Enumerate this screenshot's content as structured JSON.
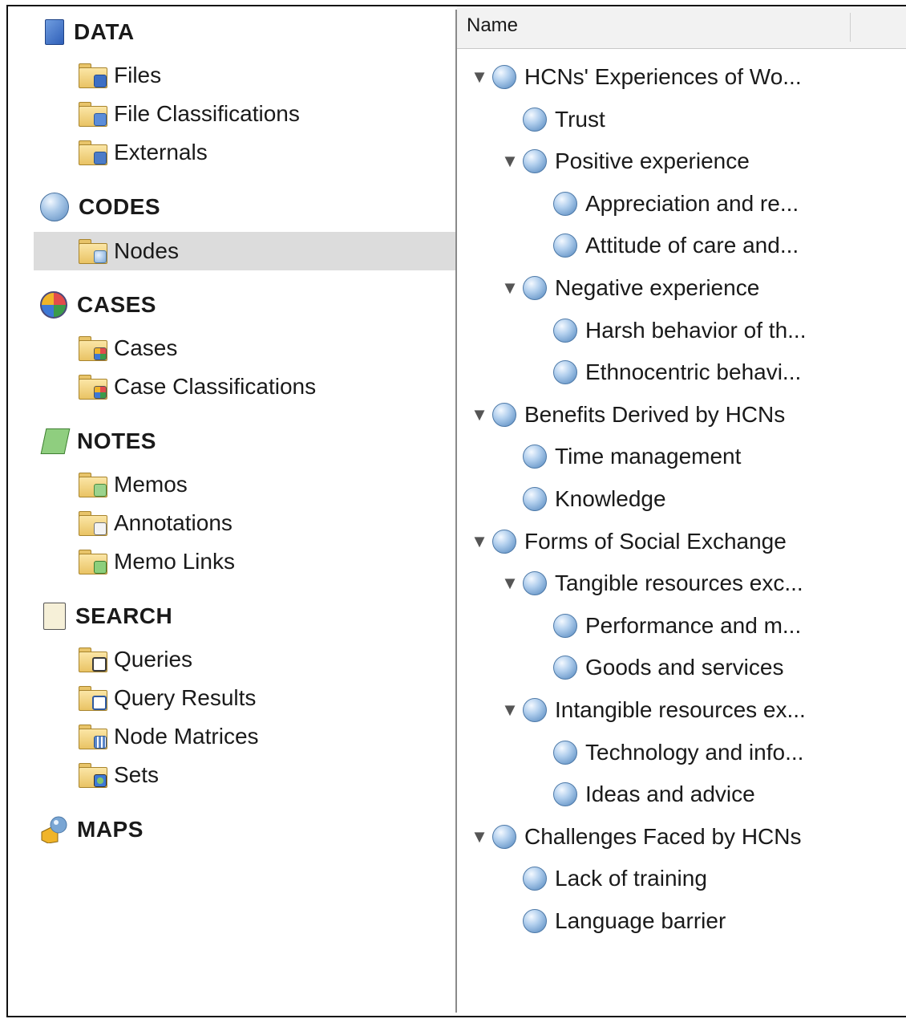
{
  "sidebar": {
    "data": {
      "title": "DATA",
      "items": [
        "Files",
        "File Classifications",
        "Externals"
      ]
    },
    "codes": {
      "title": "CODES",
      "items": [
        "Nodes"
      ]
    },
    "cases": {
      "title": "CASES",
      "items": [
        "Cases",
        "Case Classifications"
      ]
    },
    "notes": {
      "title": "NOTES",
      "items": [
        "Memos",
        "Annotations",
        "Memo Links"
      ]
    },
    "search": {
      "title": "SEARCH",
      "items": [
        "Queries",
        "Query Results",
        "Node Matrices",
        "Sets"
      ]
    },
    "maps": {
      "title": "MAPS"
    },
    "selected_item": "Nodes"
  },
  "nodes_panel": {
    "column_header": "Name",
    "rows": [
      {
        "label": "HCNs' Experiences of Wo...",
        "expanded": true
      },
      {
        "label": "Trust"
      },
      {
        "label": "Positive experience",
        "expanded": true
      },
      {
        "label": "Appreciation and re..."
      },
      {
        "label": "Attitude of care and..."
      },
      {
        "label": "Negative experience",
        "expanded": true
      },
      {
        "label": "Harsh behavior of th..."
      },
      {
        "label": "Ethnocentric behavi..."
      },
      {
        "label": "Benefits Derived by HCNs",
        "expanded": true
      },
      {
        "label": "Time management"
      },
      {
        "label": "Knowledge"
      },
      {
        "label": "Forms of Social Exchange",
        "expanded": true
      },
      {
        "label": "Tangible resources exc...",
        "expanded": true
      },
      {
        "label": "Performance and m..."
      },
      {
        "label": "Goods and services"
      },
      {
        "label": "Intangible resources ex...",
        "expanded": true
      },
      {
        "label": "Technology and info..."
      },
      {
        "label": "Ideas and advice"
      },
      {
        "label": "Challenges Faced by HCNs",
        "expanded": true
      },
      {
        "label": "Lack of training"
      },
      {
        "label": "Language barrier"
      }
    ]
  },
  "colors": {
    "selection": "#dcdcdc",
    "node_icon": "#7aa6d4"
  },
  "icons": {
    "data": "data-book-icon",
    "codes": "node-ball-icon",
    "cases": "case-pie-icon",
    "notes": "notepad-icon",
    "search": "search-document-icon",
    "maps": "maps-shapes-icon",
    "expand": "▼"
  }
}
